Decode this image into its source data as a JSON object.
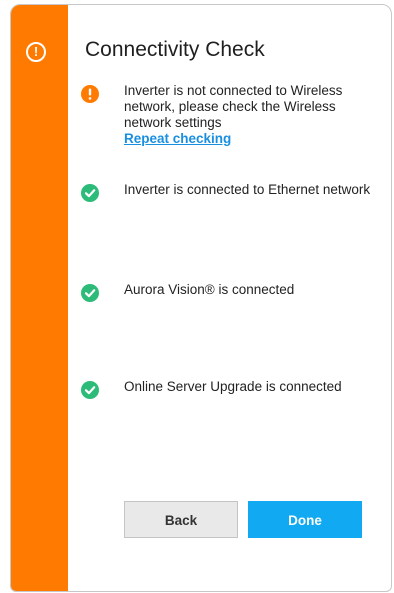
{
  "dialog": {
    "title": "Connectivity Check",
    "side_icon": "warning-circle-icon",
    "accent_color": "#ff7a00"
  },
  "items": [
    {
      "status": "warning",
      "icon": "exclamation-circle-icon",
      "icon_color": "#ff7a00",
      "text": "Inverter is not connected to Wireless network, please check the Wireless network settings",
      "link": "Repeat checking"
    },
    {
      "status": "ok",
      "icon": "check-circle-icon",
      "icon_color": "#2dbb7a",
      "text": "Inverter is connected to Ethernet network"
    },
    {
      "status": "ok",
      "icon": "check-circle-icon",
      "icon_color": "#2dbb7a",
      "text": "Aurora Vision® is connected"
    },
    {
      "status": "ok",
      "icon": "check-circle-icon",
      "icon_color": "#2dbb7a",
      "text": "Online Server Upgrade is connected"
    }
  ],
  "buttons": {
    "back_label": "Back",
    "done_label": "Done",
    "done_color": "#11aaf2"
  }
}
